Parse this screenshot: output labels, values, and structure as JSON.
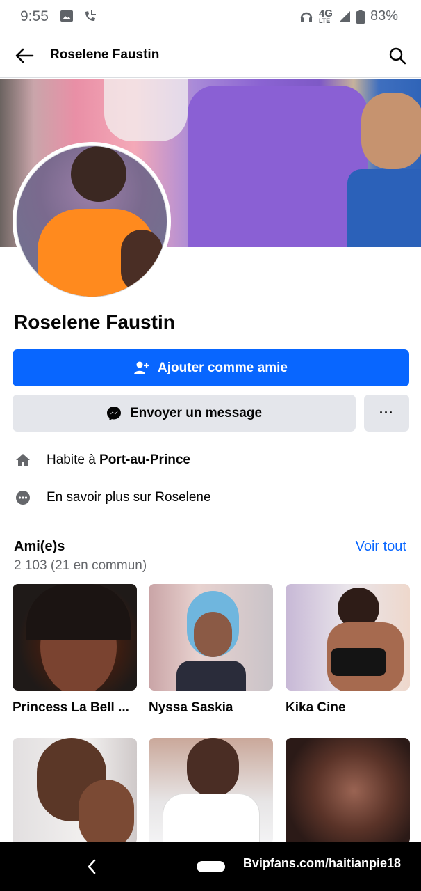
{
  "status_bar": {
    "time": "9:55",
    "network": "4G",
    "network_sub": "LTE",
    "battery": "83%"
  },
  "app_bar": {
    "title": "Roselene Faustin"
  },
  "profile": {
    "name": "Roselene Faustin",
    "add_friend_label": "Ajouter comme amie",
    "message_label": "Envoyer un message",
    "more_label": "···"
  },
  "about": {
    "lives_prefix": "Habite à ",
    "lives_city": "Port-au-Prince",
    "learn_more": "En savoir plus sur Roselene"
  },
  "friends": {
    "title": "Ami(e)s",
    "count": "2 103 (21 en commun)",
    "see_all": "Voir tout",
    "items": [
      {
        "name": "Princess La Bell ..."
      },
      {
        "name": "Nyssa Saskia"
      },
      {
        "name": "Kika Cine"
      },
      {
        "name": ""
      },
      {
        "name": ""
      },
      {
        "name": ""
      }
    ]
  },
  "nav_bar": {
    "watermark": "Bvipfans.com/haitianpie18"
  },
  "colors": {
    "primary": "#0866ff",
    "secondary_bg": "#e4e6eb",
    "muted_text": "#65676b"
  },
  "icons": [
    "back-arrow-icon",
    "search-icon",
    "add-friend-icon",
    "messenger-icon",
    "home-icon",
    "more-dots-icon"
  ]
}
